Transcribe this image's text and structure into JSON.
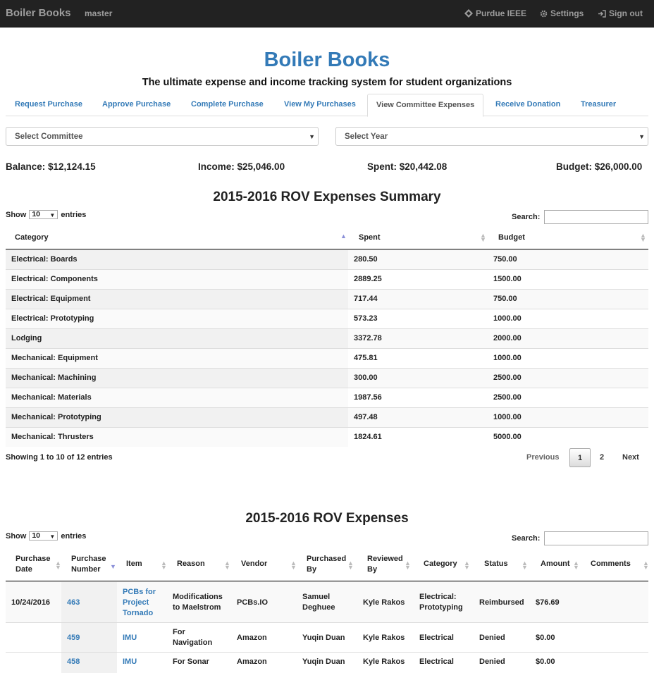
{
  "navbar": {
    "brand": "Boiler Books",
    "branch": "master",
    "org_label": "Purdue IEEE",
    "settings_label": "Settings",
    "signout_label": "Sign out"
  },
  "header": {
    "title": "Boiler Books",
    "tagline": "The ultimate expense and income tracking system for student organizations"
  },
  "tabs": [
    {
      "label": "Request Purchase"
    },
    {
      "label": "Approve Purchase"
    },
    {
      "label": "Complete Purchase"
    },
    {
      "label": "View My Purchases"
    },
    {
      "label": "View Committee Expenses",
      "active": true
    },
    {
      "label": "Receive Donation"
    },
    {
      "label": "Treasurer"
    }
  ],
  "filters": {
    "committee_placeholder": "Select Committee",
    "year_placeholder": "Select Year"
  },
  "stats": {
    "balance": "Balance: $12,124.15",
    "income": "Income: $25,046.00",
    "spent": "Spent: $20,442.08",
    "budget": "Budget: $26,000.00"
  },
  "summary": {
    "title": "2015-2016 ROV Expenses Summary",
    "show_label": "Show",
    "page_size": "10",
    "entries_label": "entries",
    "search_label": "Search:",
    "columns": [
      "Category",
      "Spent",
      "Budget"
    ],
    "rows": [
      [
        "Electrical: Boards",
        "280.50",
        "750.00"
      ],
      [
        "Electrical: Components",
        "2889.25",
        "1500.00"
      ],
      [
        "Electrical: Equipment",
        "717.44",
        "750.00"
      ],
      [
        "Electrical: Prototyping",
        "573.23",
        "1000.00"
      ],
      [
        "Lodging",
        "3372.78",
        "2000.00"
      ],
      [
        "Mechanical: Equipment",
        "475.81",
        "1000.00"
      ],
      [
        "Mechanical: Machining",
        "300.00",
        "2500.00"
      ],
      [
        "Mechanical: Materials",
        "1987.56",
        "2500.00"
      ],
      [
        "Mechanical: Prototyping",
        "497.48",
        "1000.00"
      ],
      [
        "Mechanical: Thrusters",
        "1824.61",
        "5000.00"
      ]
    ],
    "info": "Showing 1 to 10 of 12 entries",
    "pagination": {
      "previous": "Previous",
      "pages": [
        "1",
        "2"
      ],
      "current": "1",
      "next": "Next"
    }
  },
  "expenses": {
    "title": "2015-2016 ROV Expenses",
    "show_label": "Show",
    "page_size": "10",
    "entries_label": "entries",
    "search_label": "Search:",
    "columns": [
      [
        "Purchase",
        "Date"
      ],
      [
        "Purchase",
        "Number"
      ],
      [
        "Item"
      ],
      [
        "Reason"
      ],
      [
        "Vendor"
      ],
      [
        "Purchased",
        "By"
      ],
      [
        "Reviewed",
        "By"
      ],
      [
        "Category"
      ],
      [
        "Status"
      ],
      [
        "Amount"
      ],
      [
        "Comments"
      ]
    ],
    "rows": [
      {
        "date": "10/24/2016",
        "number": "463",
        "item": [
          "PCBs for",
          "Project",
          "Tornado"
        ],
        "reason": [
          "Modifications",
          "to Maelstrom"
        ],
        "vendor": "PCBs.IO",
        "purchased_by": [
          "Samuel",
          "Deghuee"
        ],
        "reviewed_by": "Kyle Rakos",
        "category": [
          "Electrical:",
          "Prototyping"
        ],
        "status": "Reimbursed",
        "amount": "$76.69",
        "comments": ""
      },
      {
        "date": "",
        "number": "459",
        "item": [
          "IMU"
        ],
        "reason": [
          "For",
          "Navigation"
        ],
        "vendor": "Amazon",
        "purchased_by": [
          "Yuqin Duan"
        ],
        "reviewed_by": "Kyle Rakos",
        "category": [
          "Electrical"
        ],
        "status": "Denied",
        "amount": "$0.00",
        "comments": ""
      },
      {
        "date": "",
        "number": "458",
        "item": [
          "IMU"
        ],
        "reason": [
          "For Sonar"
        ],
        "vendor": "Amazon",
        "purchased_by": [
          "Yuqin Duan"
        ],
        "reviewed_by": "Kyle Rakos",
        "category": [
          "Electrical"
        ],
        "status": "Denied",
        "amount": "$0.00",
        "comments": ""
      }
    ]
  },
  "colors": {
    "navbar_bg": "#222222",
    "link": "#337ab7",
    "sort_active": "#8a8fd8"
  }
}
